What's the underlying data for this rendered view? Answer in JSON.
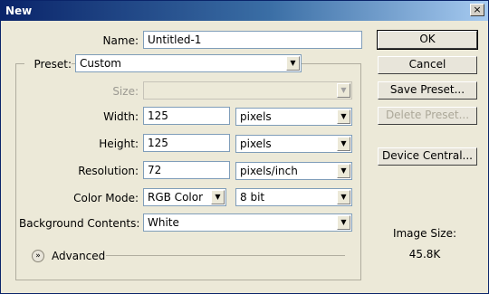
{
  "window": {
    "title": "New",
    "close_glyph": "×"
  },
  "form": {
    "name": {
      "label": "Name:",
      "value": "Untitled-1"
    },
    "preset": {
      "label": "Preset:",
      "value": "Custom"
    },
    "size": {
      "label": "Size:",
      "value": ""
    },
    "width": {
      "label": "Width:",
      "value": "125",
      "unit": "pixels"
    },
    "height": {
      "label": "Height:",
      "value": "125",
      "unit": "pixels"
    },
    "resolution": {
      "label": "Resolution:",
      "value": "72",
      "unit": "pixels/inch"
    },
    "color_mode": {
      "label": "Color Mode:",
      "mode": "RGB Color",
      "depth": "8 bit"
    },
    "background": {
      "label": "Background Contents:",
      "value": "White"
    },
    "advanced": {
      "label": "Advanced"
    }
  },
  "buttons": {
    "ok": "OK",
    "cancel": "Cancel",
    "save_preset": "Save Preset...",
    "delete_preset": "Delete Preset...",
    "device_central": "Device Central..."
  },
  "image_size": {
    "label": "Image Size:",
    "value": "45.8K"
  },
  "icons": {
    "dropdown": "▼",
    "advanced_toggle": "»"
  }
}
